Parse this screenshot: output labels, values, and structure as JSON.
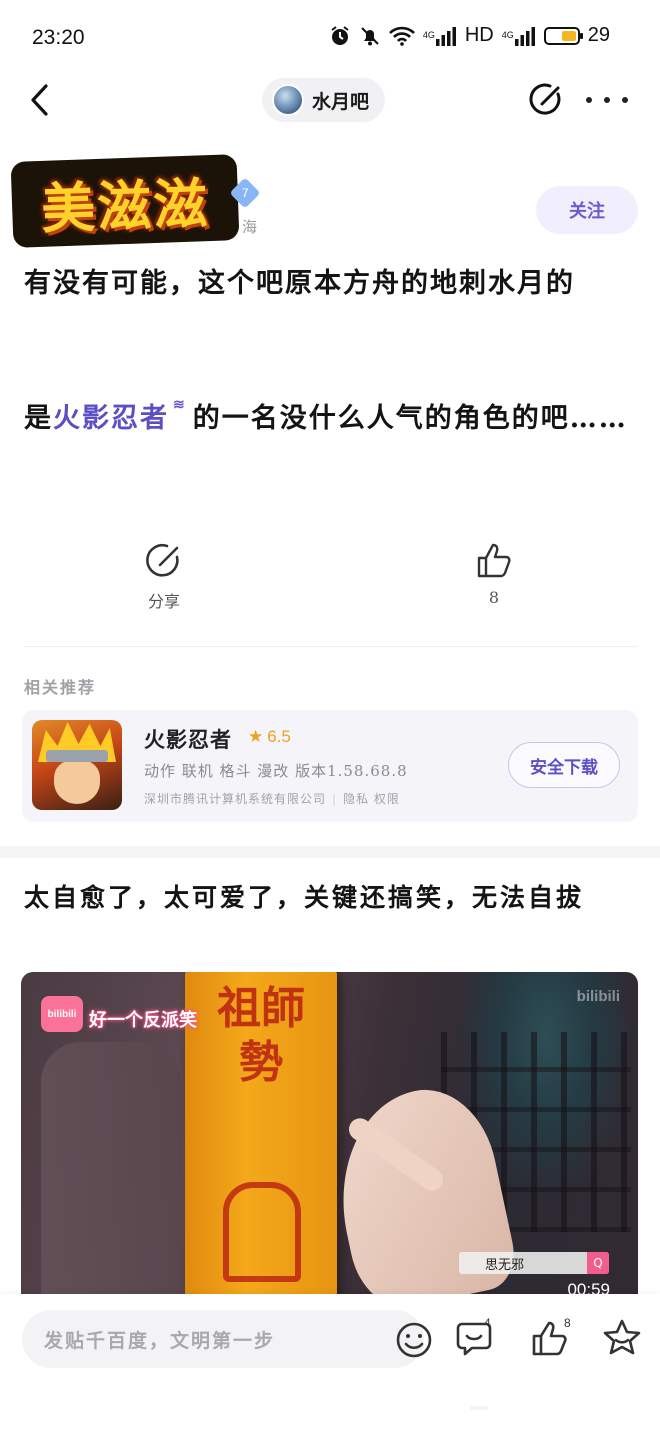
{
  "status_bar": {
    "time": "23:20",
    "hd_label": "HD",
    "net_tag_1": "4G",
    "net_tag_2": "4G",
    "battery_level": "29"
  },
  "nav": {
    "forum_name": "水月吧"
  },
  "author": {
    "name_logo": "美滋滋",
    "level": "7",
    "location": "海",
    "follow_label": "关注"
  },
  "post": {
    "line1": "有没有可能，这个吧原本方舟的地刺水月的",
    "para2_prefix": "是",
    "tag_link": "火影忍者",
    "para2_suffix": "的一名没什么人气的角色的吧……"
  },
  "actions": {
    "share_label": "分享",
    "like_count": "8"
  },
  "related": {
    "title": "相关推荐",
    "app_name": "火影忍者",
    "rating": "6.5",
    "tags": "动作  联机  格斗  漫改   版本1.58.68.8",
    "developer": "深圳市腾讯计算机系统有限公司",
    "privacy": "隐私",
    "permissions": "权限",
    "download_label": "安全下载"
  },
  "post2": {
    "text": "太自愈了，太可爱了，关键还搞笑，无法自拔",
    "video": {
      "logo_text": "bilibili",
      "channel": "好一个反派笑",
      "watermark": "bilibili",
      "talisman_text": "祖師勢",
      "search_text": "思无邪",
      "duration": "00:59"
    }
  },
  "bottom_bar": {
    "comment_placeholder": "发贴千百度，文明第一步",
    "comment_count": "4",
    "like_count": "8"
  },
  "colors": {
    "accent": "#5b4fc4",
    "follow_bg": "#f1effd",
    "rating": "#f0a020",
    "bilibili_pink": "#fb7299"
  }
}
